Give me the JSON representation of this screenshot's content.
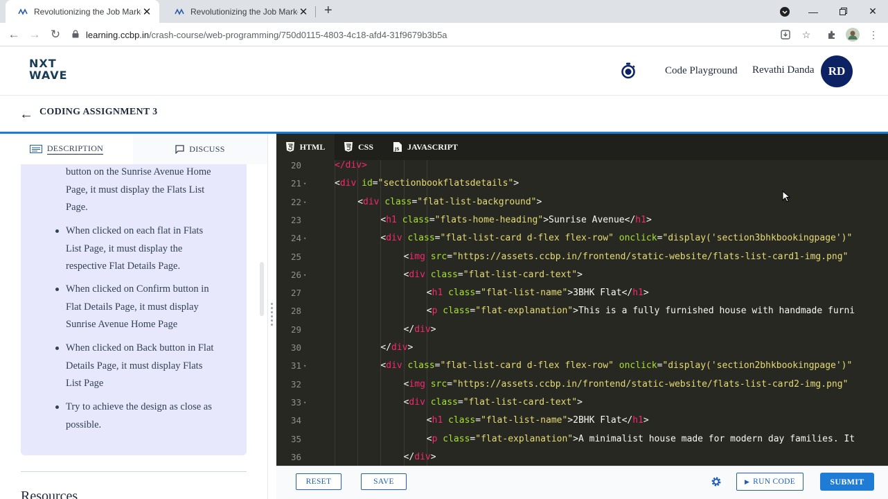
{
  "browser": {
    "tabs": [
      {
        "title": "Revolutionizing the Job Market |",
        "active": true
      },
      {
        "title": "Revolutionizing the Job Market |",
        "active": false
      }
    ],
    "url_host": "learning.ccbp.in",
    "url_path": "/crash-course/web-programming/750d0115-4803-4c18-afd4-31f9679b3b5a"
  },
  "header": {
    "logo_line1": "NXT",
    "logo_line2": "WAVE",
    "code_playground": "Code Playground",
    "user_name": "Revathi Danda",
    "avatar_initials": "RD"
  },
  "assignment": {
    "title": "CODING ASSIGNMENT 3"
  },
  "left_panel": {
    "tabs": {
      "description": "DESCRIPTION",
      "discuss": "DISCUSS"
    },
    "items": [
      {
        "lines": [
          "button on the Sunrise Avenue Home",
          "Page, it must display the Flats List",
          "Page."
        ],
        "bullet": false
      },
      {
        "lines": [
          "When clicked on each flat in Flats",
          "List Page, it must display the",
          "respective Flat Details Page."
        ],
        "bullet": true
      },
      {
        "lines": [
          "When clicked on Confirm button in",
          "Flat Details Page, it must display",
          "Sunrise Avenue Home Page"
        ],
        "bullet": true
      },
      {
        "lines": [
          "When clicked on Back button in Flat",
          "Details Page, it must display Flats",
          "List Page"
        ],
        "bullet": true
      },
      {
        "lines": [
          "Try to achieve the design as close as",
          "possible."
        ],
        "bullet": true
      }
    ],
    "resources_heading": "Resources"
  },
  "editor": {
    "tabs": {
      "html": "HTML",
      "css": "CSS",
      "javascript": "JAVASCRIPT"
    },
    "lines": [
      {
        "n": "20",
        "fold": false,
        "indent": 1,
        "tokens": [
          [
            "tag",
            "</"
          ],
          [
            "tag",
            "div"
          ],
          [
            "tag",
            ">"
          ]
        ]
      },
      {
        "n": "21",
        "fold": true,
        "indent": 1,
        "tokens": [
          [
            "txt",
            "<"
          ],
          [
            "tag",
            "div"
          ],
          [
            "txt",
            " "
          ],
          [
            "attr",
            "id"
          ],
          [
            "txt",
            "="
          ],
          [
            "str",
            "\"sectionbookflatsdetails\""
          ],
          [
            "txt",
            ">"
          ]
        ]
      },
      {
        "n": "22",
        "fold": true,
        "indent": 2,
        "tokens": [
          [
            "txt",
            "<"
          ],
          [
            "tag",
            "div"
          ],
          [
            "txt",
            " "
          ],
          [
            "attr",
            "class"
          ],
          [
            "txt",
            "="
          ],
          [
            "str",
            "\"flat-list-background\""
          ],
          [
            "txt",
            ">"
          ]
        ]
      },
      {
        "n": "23",
        "fold": false,
        "indent": 3,
        "tokens": [
          [
            "txt",
            "<"
          ],
          [
            "tag",
            "h1"
          ],
          [
            "txt",
            " "
          ],
          [
            "attr",
            "class"
          ],
          [
            "txt",
            "="
          ],
          [
            "str",
            "\"flats-home-heading\""
          ],
          [
            "txt",
            ">Sunrise Avenue</"
          ],
          [
            "tag",
            "h1"
          ],
          [
            "txt",
            ">"
          ]
        ]
      },
      {
        "n": "24",
        "fold": true,
        "indent": 3,
        "tokens": [
          [
            "txt",
            "<"
          ],
          [
            "tag",
            "div"
          ],
          [
            "txt",
            " "
          ],
          [
            "attr",
            "class"
          ],
          [
            "txt",
            "="
          ],
          [
            "str",
            "\"flat-list-card d-flex flex-row\""
          ],
          [
            "txt",
            " "
          ],
          [
            "attr",
            "onclick"
          ],
          [
            "txt",
            "="
          ],
          [
            "str",
            "\"display('section3bhkbookingpage')\""
          ]
        ]
      },
      {
        "n": "25",
        "fold": false,
        "indent": 4,
        "tokens": [
          [
            "txt",
            "<"
          ],
          [
            "tag",
            "img"
          ],
          [
            "txt",
            " "
          ],
          [
            "attr",
            "src"
          ],
          [
            "txt",
            "="
          ],
          [
            "str",
            "\"https://assets.ccbp.in/frontend/static-website/flats-list-card1-img.png\""
          ]
        ]
      },
      {
        "n": "26",
        "fold": true,
        "indent": 4,
        "tokens": [
          [
            "txt",
            "<"
          ],
          [
            "tag",
            "div"
          ],
          [
            "txt",
            " "
          ],
          [
            "attr",
            "class"
          ],
          [
            "txt",
            "="
          ],
          [
            "str",
            "\"flat-list-card-text\""
          ],
          [
            "txt",
            ">"
          ]
        ]
      },
      {
        "n": "27",
        "fold": false,
        "indent": 5,
        "tokens": [
          [
            "txt",
            "<"
          ],
          [
            "tag",
            "h1"
          ],
          [
            "txt",
            " "
          ],
          [
            "attr",
            "class"
          ],
          [
            "txt",
            "="
          ],
          [
            "str",
            "\"flat-list-name\""
          ],
          [
            "txt",
            ">3BHK Flat</"
          ],
          [
            "tag",
            "h1"
          ],
          [
            "txt",
            ">"
          ]
        ]
      },
      {
        "n": "28",
        "fold": false,
        "indent": 5,
        "tokens": [
          [
            "txt",
            "<"
          ],
          [
            "tag",
            "p"
          ],
          [
            "txt",
            " "
          ],
          [
            "attr",
            "class"
          ],
          [
            "txt",
            "="
          ],
          [
            "str",
            "\"flat-explanation\""
          ],
          [
            "txt",
            ">This is a fully furnished house with handmade furni"
          ]
        ]
      },
      {
        "n": "29",
        "fold": false,
        "indent": 4,
        "tokens": [
          [
            "txt",
            "</"
          ],
          [
            "tag",
            "div"
          ],
          [
            "txt",
            ">"
          ]
        ]
      },
      {
        "n": "30",
        "fold": false,
        "indent": 3,
        "tokens": [
          [
            "txt",
            "</"
          ],
          [
            "tag",
            "div"
          ],
          [
            "txt",
            ">"
          ]
        ]
      },
      {
        "n": "31",
        "fold": true,
        "indent": 3,
        "tokens": [
          [
            "txt",
            "<"
          ],
          [
            "tag",
            "div"
          ],
          [
            "txt",
            " "
          ],
          [
            "attr",
            "class"
          ],
          [
            "txt",
            "="
          ],
          [
            "str",
            "\"flat-list-card d-flex flex-row\""
          ],
          [
            "txt",
            " "
          ],
          [
            "attr",
            "onclick"
          ],
          [
            "txt",
            "="
          ],
          [
            "str",
            "\"display('section2bhkbookingpage')\""
          ]
        ]
      },
      {
        "n": "32",
        "fold": false,
        "indent": 4,
        "tokens": [
          [
            "txt",
            "<"
          ],
          [
            "tag",
            "img"
          ],
          [
            "txt",
            " "
          ],
          [
            "attr",
            "src"
          ],
          [
            "txt",
            "="
          ],
          [
            "str",
            "\"https://assets.ccbp.in/frontend/static-website/flats-list-card2-img.png\""
          ]
        ]
      },
      {
        "n": "33",
        "fold": true,
        "indent": 4,
        "tokens": [
          [
            "txt",
            "<"
          ],
          [
            "tag",
            "div"
          ],
          [
            "txt",
            " "
          ],
          [
            "attr",
            "class"
          ],
          [
            "txt",
            "="
          ],
          [
            "str",
            "\"flat-list-card-text\""
          ],
          [
            "txt",
            ">"
          ]
        ]
      },
      {
        "n": "34",
        "fold": false,
        "indent": 5,
        "tokens": [
          [
            "txt",
            "<"
          ],
          [
            "tag",
            "h1"
          ],
          [
            "txt",
            " "
          ],
          [
            "attr",
            "class"
          ],
          [
            "txt",
            "="
          ],
          [
            "str",
            "\"flat-list-name\""
          ],
          [
            "txt",
            ">2BHK Flat</"
          ],
          [
            "tag",
            "h1"
          ],
          [
            "txt",
            ">"
          ]
        ]
      },
      {
        "n": "35",
        "fold": false,
        "indent": 5,
        "tokens": [
          [
            "txt",
            "<"
          ],
          [
            "tag",
            "p"
          ],
          [
            "txt",
            " "
          ],
          [
            "attr",
            "class"
          ],
          [
            "txt",
            "="
          ],
          [
            "str",
            "\"flat-explanation\""
          ],
          [
            "txt",
            ">A minimalist house made for modern day families. It"
          ]
        ]
      },
      {
        "n": "36",
        "fold": false,
        "indent": 4,
        "tokens": [
          [
            "txt",
            "</"
          ],
          [
            "tag",
            "div"
          ],
          [
            "txt",
            ">"
          ]
        ]
      }
    ]
  },
  "actions": {
    "reset": "RESET",
    "save": "SAVE",
    "run": "RUN CODE",
    "submit": "SUBMIT"
  },
  "colors": {
    "brand_blue": "#1e7bd6",
    "avatar_navy": "#0c2263",
    "editor_bg": "#272822",
    "desc_card": "#e7e8fb"
  }
}
